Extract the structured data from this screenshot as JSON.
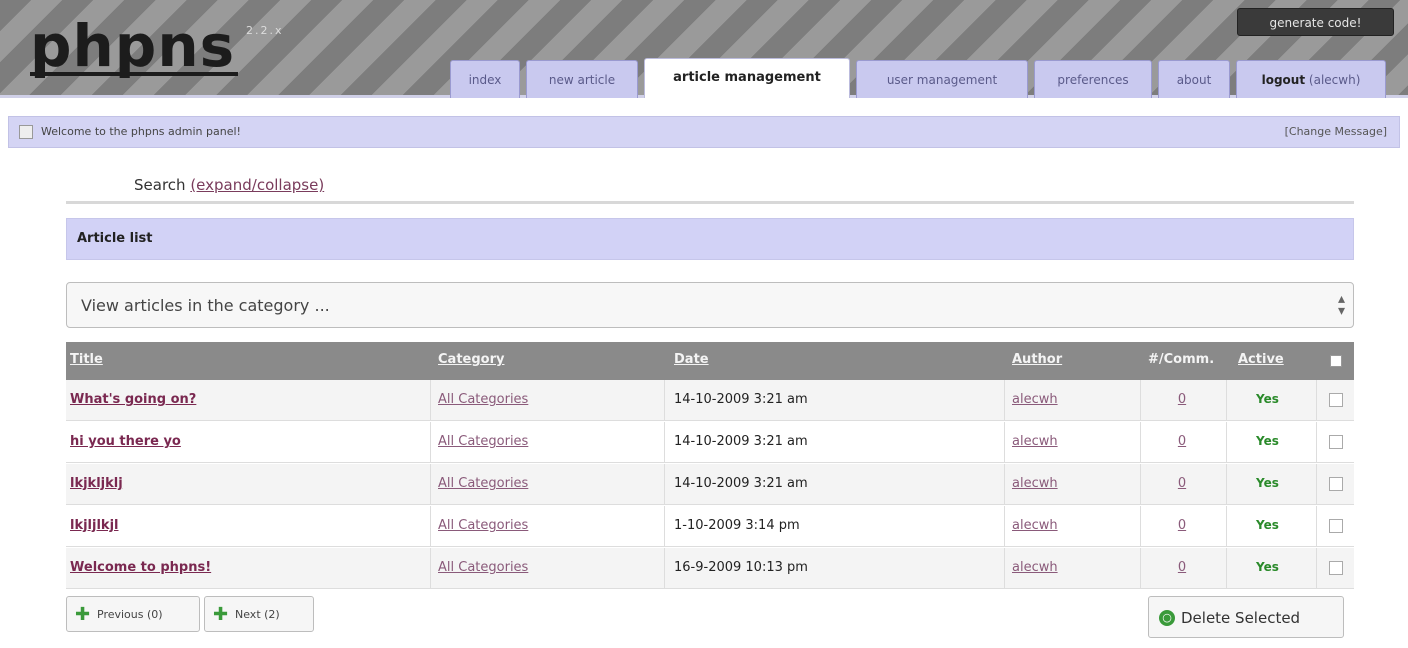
{
  "app": {
    "logo": "phpns",
    "version": "2.2.x",
    "generate_code": "generate code!"
  },
  "tabs": [
    {
      "label": "index"
    },
    {
      "label": "new article"
    },
    {
      "label": "article management"
    },
    {
      "label": "user management"
    },
    {
      "label": "preferences"
    },
    {
      "label": "about"
    },
    {
      "label_bold": "logout",
      "label_rest": "(alecwh)"
    }
  ],
  "welcome": {
    "text": "Welcome to the phpns admin panel!",
    "change_message": "[Change Message]"
  },
  "search": {
    "label": "Search",
    "toggle": "(expand/collapse)"
  },
  "article_list": {
    "title": "Article list",
    "category_select": "View articles in the category ...",
    "columns": {
      "title": "Title",
      "category": "Category",
      "date": "Date",
      "author": "Author",
      "comments": "#/Comm.",
      "active": "Active"
    },
    "rows": [
      {
        "title": "What's going on?",
        "category": "All Categories",
        "date": "14-10-2009 3:21 am",
        "author": "alecwh",
        "comments": "0",
        "active": "Yes"
      },
      {
        "title": "hi you there yo",
        "category": "All Categories",
        "date": "14-10-2009 3:21 am",
        "author": "alecwh",
        "comments": "0",
        "active": "Yes"
      },
      {
        "title": "lkjkljklj",
        "category": "All Categories",
        "date": "14-10-2009 3:21 am",
        "author": "alecwh",
        "comments": "0",
        "active": "Yes"
      },
      {
        "title": "lkjljlkjl",
        "category": "All Categories",
        "date": "1-10-2009 3:14 pm",
        "author": "alecwh",
        "comments": "0",
        "active": "Yes"
      },
      {
        "title": "Welcome to phpns!",
        "category": "All Categories",
        "date": "16-9-2009 10:13 pm",
        "author": "alecwh",
        "comments": "0",
        "active": "Yes"
      }
    ]
  },
  "pagination": {
    "previous": "Previous (0)",
    "next": "Next (2)"
  },
  "delete_selected": "Delete Selected"
}
